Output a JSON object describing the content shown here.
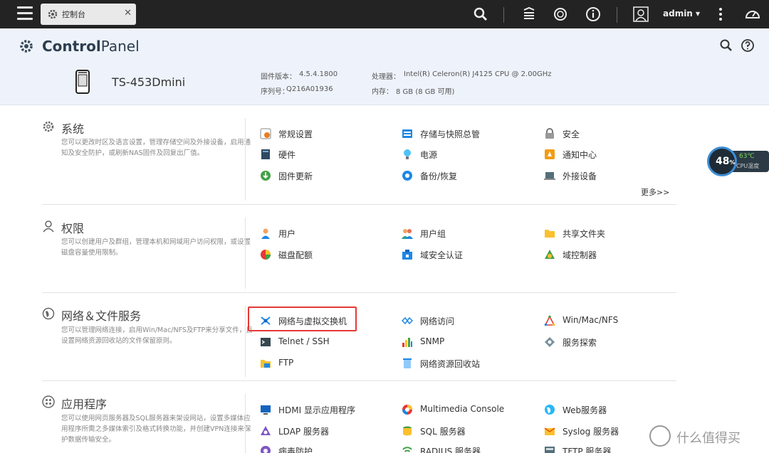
{
  "tab": {
    "label": "控制台"
  },
  "topbar": {
    "user": "admin ▾"
  },
  "header": {
    "title_bold": "Control",
    "title_rest": "Panel",
    "device_name": "TS-453Dmini",
    "fw_label": "固件版本：",
    "fw_value": "4.5.4.1800",
    "sn_label": "序列号：",
    "sn_value": "Q216A01936",
    "cpu_label": "处理器：",
    "cpu_value": "Intel(R) Celeron(R) J4125 CPU @ 2.00GHz",
    "mem_label": "内存：",
    "mem_value": "8 GB (8 GB 可用)"
  },
  "sections": [
    {
      "title": "系统",
      "desc": "您可以更改时区及语言设置，管理存储空间及外接设备，启用通知及安全防护，或刷新NAS固件及回复出厂值。",
      "items": [
        {
          "label": "常规设置",
          "icon": "general-settings-icon"
        },
        {
          "label": "存储与快照总管",
          "icon": "storage-icon"
        },
        {
          "label": "安全",
          "icon": "lock-icon"
        },
        {
          "label": "硬件",
          "icon": "hardware-icon"
        },
        {
          "label": "电源",
          "icon": "power-bulb-icon"
        },
        {
          "label": "通知中心",
          "icon": "notification-icon"
        },
        {
          "label": "固件更新",
          "icon": "firmware-update-icon"
        },
        {
          "label": "备份/恢复",
          "icon": "backup-icon"
        },
        {
          "label": "外接设备",
          "icon": "external-device-icon"
        }
      ],
      "more": "更多>>"
    },
    {
      "title": "权限",
      "desc": "您可以创建用户及群组，管理本机和网域用户访问权限，或设置磁盘容量使用限制。",
      "items": [
        {
          "label": "用户",
          "icon": "user-icon"
        },
        {
          "label": "用户组",
          "icon": "user-group-icon"
        },
        {
          "label": "共享文件夹",
          "icon": "shared-folder-icon"
        },
        {
          "label": "磁盘配额",
          "icon": "quota-icon"
        },
        {
          "label": "域安全认证",
          "icon": "domain-security-icon"
        },
        {
          "label": "域控制器",
          "icon": "domain-controller-icon"
        }
      ]
    },
    {
      "title": "网络＆文件服务",
      "desc": "您可以管理网络连接，启用Win/Mac/NFS及FTP来分享文件，且设置网络资源回收站的文件保留原则。",
      "items": [
        {
          "label": "网络与虚拟交换机",
          "icon": "network-switch-icon"
        },
        {
          "label": "网络访问",
          "icon": "network-access-icon"
        },
        {
          "label": "Win/Mac/NFS",
          "icon": "win-mac-nfs-icon"
        },
        {
          "label": "Telnet / SSH",
          "icon": "terminal-icon"
        },
        {
          "label": "SNMP",
          "icon": "snmp-icon"
        },
        {
          "label": "服务探索",
          "icon": "service-discovery-icon"
        },
        {
          "label": "FTP",
          "icon": "ftp-icon"
        },
        {
          "label": "网络资源回收站",
          "icon": "recycle-bin-icon"
        }
      ]
    },
    {
      "title": "应用程序",
      "desc": "您可以使用网页服务器及SQL服务器来架设网站，设置多媒体应用程序所需之多媒体索引及格式转换功能，并创建VPN连接来保护数据传输安全。",
      "items": [
        {
          "label": "HDMI 显示应用程序",
          "icon": "hdmi-icon"
        },
        {
          "label": "Multimedia Console",
          "icon": "multimedia-icon"
        },
        {
          "label": "Web服务器",
          "icon": "web-server-icon"
        },
        {
          "label": "LDAP 服务器",
          "icon": "ldap-icon"
        },
        {
          "label": "SQL 服务器",
          "icon": "sql-icon"
        },
        {
          "label": "Syslog 服务器",
          "icon": "syslog-icon"
        },
        {
          "label": "病毒防护",
          "icon": "antivirus-icon"
        },
        {
          "label": "RADIUS 服务器",
          "icon": "radius-icon"
        },
        {
          "label": "TFTP 服务器",
          "icon": "tftp-icon"
        }
      ]
    }
  ],
  "cpu_widget": {
    "percent": "48",
    "unit": "%",
    "temp": "63℃",
    "label": "CPU温度"
  },
  "watermark": {
    "text": "什么值得买"
  }
}
